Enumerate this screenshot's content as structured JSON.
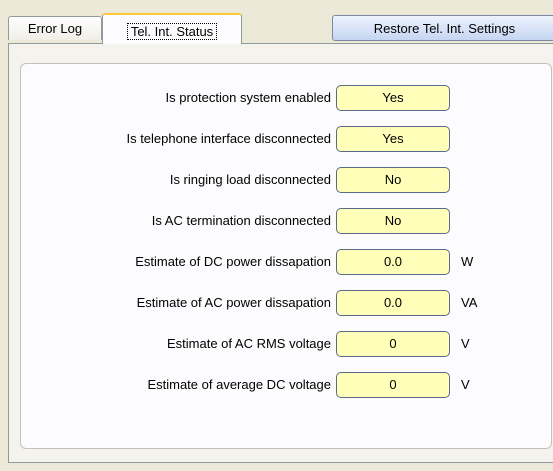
{
  "tabs": [
    {
      "label": "Error Log"
    },
    {
      "label": "Tel. Int. Status"
    }
  ],
  "restore_button": {
    "label": "Restore Tel. Int. Settings"
  },
  "status": {
    "rows": [
      {
        "label": "Is protection system enabled",
        "value": "Yes",
        "unit": ""
      },
      {
        "label": "Is telephone interface disconnected",
        "value": "Yes",
        "unit": ""
      },
      {
        "label": "Is ringing load disconnected",
        "value": "No",
        "unit": ""
      },
      {
        "label": "Is AC termination disconnected",
        "value": "No",
        "unit": ""
      },
      {
        "label": "Estimate of DC power dissapation",
        "value": "0.0",
        "unit": "W"
      },
      {
        "label": "Estimate of AC power dissapation",
        "value": "0.0",
        "unit": "VA"
      },
      {
        "label": "Estimate of AC RMS voltage",
        "value": "0",
        "unit": "V"
      },
      {
        "label": "Estimate of average DC voltage",
        "value": "0",
        "unit": "V"
      }
    ]
  },
  "colors": {
    "field_background": "#ffffb9",
    "active_tab_highlight": "#ffc83c",
    "button_gradient_bottom": "#c5d5f2"
  }
}
